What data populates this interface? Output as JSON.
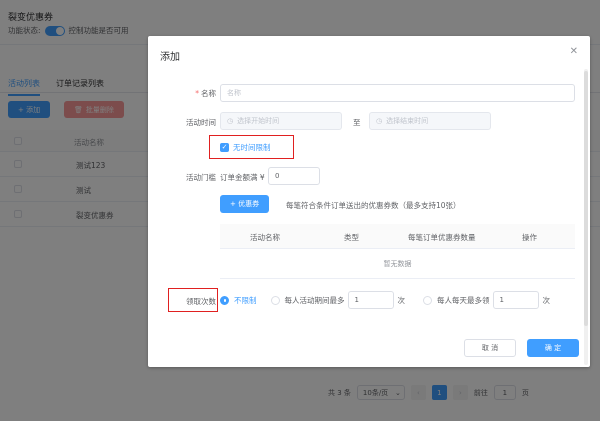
{
  "background": {
    "title": "裂变优惠券",
    "status_label": "功能状态:",
    "status_hint": "控制功能是否可用",
    "tabs": [
      "活动列表",
      "订单记录列表"
    ],
    "add_button": "+ 添加",
    "delete_button": "批量删除",
    "table_header": "活动名称",
    "rows": [
      "测试123",
      "测试",
      "裂变优惠券"
    ],
    "pager": {
      "total": "共 3 条",
      "page_size": "10条/页",
      "current_page": "1",
      "goto_label": "前往",
      "goto_value": "1",
      "page_suffix": "页"
    }
  },
  "dialog": {
    "title": "添加",
    "close_icon": "close-icon",
    "name_label": "名称",
    "name_placeholder": "名称",
    "time_label": "活动时间",
    "start_placeholder": "选择开始时间",
    "to_text": "至",
    "end_placeholder": "选择结束时间",
    "no_time_limit": "无时间限制",
    "threshold_label": "活动门槛",
    "threshold_prefix": "订单金额满 ¥",
    "threshold_value": "0",
    "coupon_button": "+ 优惠券",
    "coupon_hint": "每笔符合条件订单送出的优惠券数（最多支持10张）",
    "coupon_table": {
      "columns": [
        "活动名称",
        "类型",
        "每笔订单优惠券数量",
        "操作"
      ],
      "empty_text": "暂无数据"
    },
    "claim_label": "领取次数",
    "claim_options": {
      "unlimited": "不限制",
      "per_activity": "每人活动期间最多",
      "per_activity_value": "1",
      "per_day": "每人每天最多领",
      "per_day_value": "1",
      "unit": "次"
    },
    "cancel_button": "取 消",
    "confirm_button": "确 定"
  },
  "colors": {
    "primary": "#409eff",
    "highlight_box": "#e02020",
    "overlay": "rgba(0,0,0,0.5)"
  }
}
